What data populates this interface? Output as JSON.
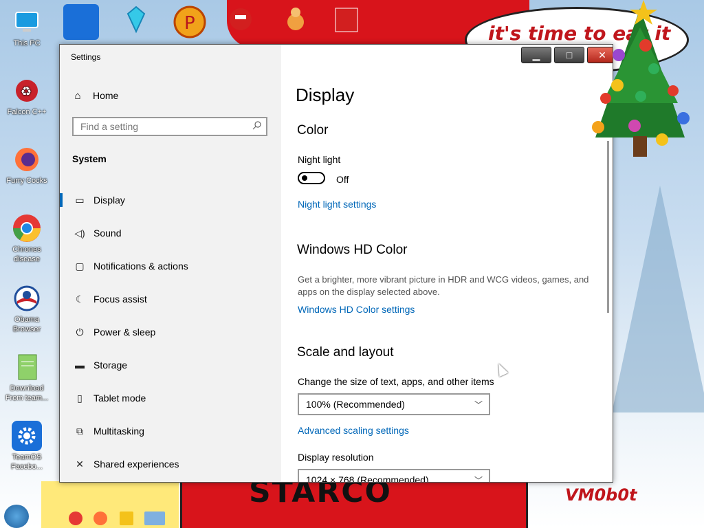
{
  "wallpaper": {
    "bubble_text": "it's time to eat it",
    "bottom_text": "STARCO",
    "signature": "VM0b0t"
  },
  "desktop_icons": [
    {
      "label": "This PC"
    },
    {
      "label": "Falcon C++"
    },
    {
      "label": "Furry Cocks"
    },
    {
      "label": "Chrones disease"
    },
    {
      "label": "Obama Browser"
    },
    {
      "label": "Download From team..."
    },
    {
      "label": "TeamOS Facebo..."
    }
  ],
  "settings": {
    "app_title": "Settings",
    "sidebar": {
      "home_label": "Home",
      "search_placeholder": "Find a setting",
      "group_title": "System",
      "items": [
        {
          "label": "Display",
          "icon": "monitor-icon",
          "active": true
        },
        {
          "label": "Sound",
          "icon": "speaker-icon"
        },
        {
          "label": "Notifications & actions",
          "icon": "notification-icon"
        },
        {
          "label": "Focus assist",
          "icon": "moon-icon"
        },
        {
          "label": "Power & sleep",
          "icon": "power-icon"
        },
        {
          "label": "Storage",
          "icon": "storage-icon"
        },
        {
          "label": "Tablet mode",
          "icon": "tablet-icon"
        },
        {
          "label": "Multitasking",
          "icon": "multitasking-icon"
        },
        {
          "label": "Shared experiences",
          "icon": "shared-icon"
        }
      ]
    },
    "content": {
      "page_title": "Display",
      "color_heading": "Color",
      "night_light_label": "Night light",
      "night_light_state": "Off",
      "night_light_settings_link": "Night light settings",
      "hd_color_heading": "Windows HD Color",
      "hd_color_desc": "Get a brighter, more vibrant picture in HDR and WCG videos, games, and apps on the display selected above.",
      "hd_color_link": "Windows HD Color settings",
      "scale_heading": "Scale and layout",
      "scale_label": "Change the size of text, apps, and other items",
      "scale_value": "100% (Recommended)",
      "advanced_scaling_link": "Advanced scaling settings",
      "resolution_label": "Display resolution",
      "resolution_value": "1024 × 768 (Recommended)"
    }
  },
  "colors": {
    "accent": "#0067b8",
    "sidebar_bg": "#f2f2f2"
  }
}
